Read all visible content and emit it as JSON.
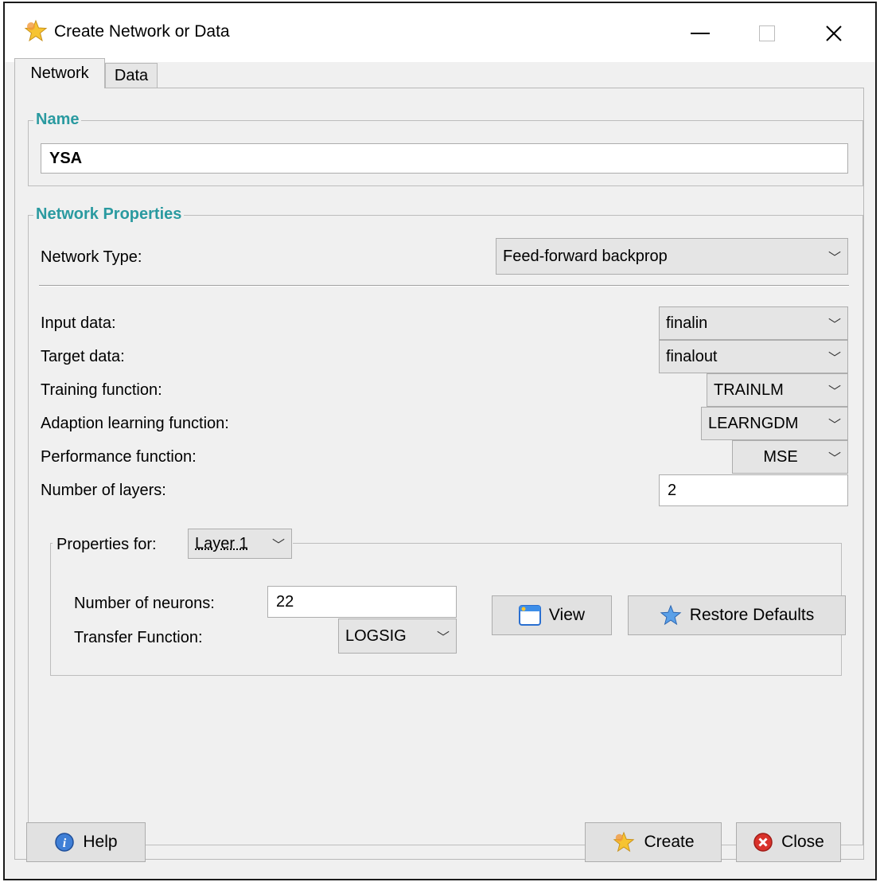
{
  "window": {
    "title": "Create Network or Data",
    "icon": "star-icon",
    "minimize": "—",
    "maximize": "☐",
    "close": "✕"
  },
  "tabs": [
    {
      "label": "Network",
      "active": true
    },
    {
      "label": "Data",
      "active": false
    }
  ],
  "name_group": {
    "legend": "Name",
    "value": "YSA"
  },
  "props_group": {
    "legend": "Network Properties",
    "network_type": {
      "label": "Network Type:",
      "value": "Feed-forward backprop"
    },
    "input_data": {
      "label": "Input data:",
      "value": "finalin"
    },
    "target_data": {
      "label": "Target data:",
      "value": "finalout"
    },
    "training_fn": {
      "label": "Training function:",
      "value": "TRAINLM"
    },
    "adaption_fn": {
      "label": "Adaption learning function:",
      "value": "LEARNGDM"
    },
    "performance_fn": {
      "label": "Performance function:",
      "value": "MSE"
    },
    "num_layers": {
      "label": "Number of layers:",
      "value": "2"
    }
  },
  "layer_group": {
    "legend": "Properties for:",
    "layer": "Layer 1",
    "neurons": {
      "label": "Number of neurons:",
      "value": "22"
    },
    "transfer": {
      "label": "Transfer Function:",
      "value": "LOGSIG"
    }
  },
  "buttons": {
    "view": "View",
    "restore": "Restore Defaults",
    "help": "Help",
    "create": "Create",
    "close": "Close"
  },
  "colors": {
    "legend": "#2a9aa0",
    "window_bg": "#f0f0f0",
    "button_bg": "#e1e1e1",
    "close_red": "#d9322b"
  }
}
